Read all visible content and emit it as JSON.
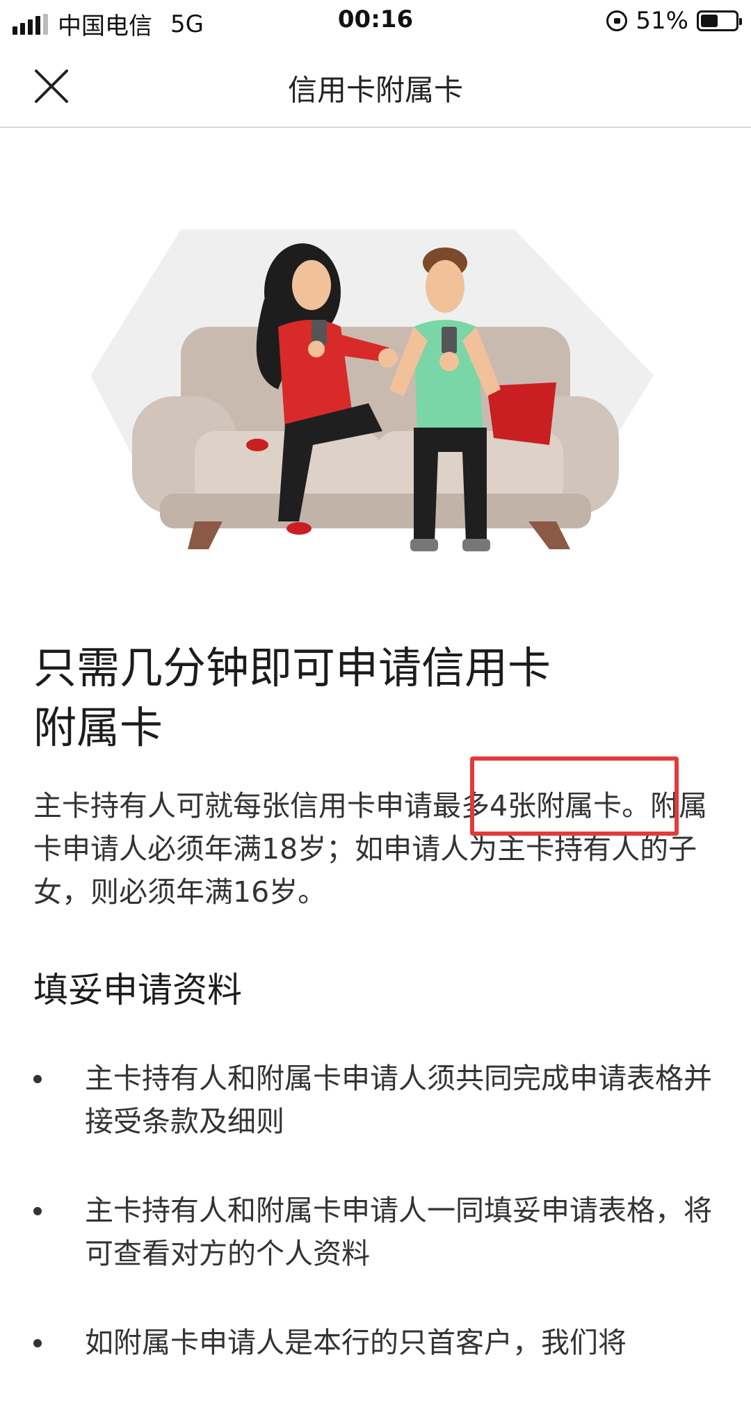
{
  "status_bar": {
    "carrier": "中国电信",
    "network": "5G",
    "time": "00:16",
    "battery": "51%",
    "battery_level": 0.51
  },
  "nav": {
    "title": "信用卡附属卡"
  },
  "hero": {
    "icon": "couple-on-sofa-illustration"
  },
  "content": {
    "headline_line1": "只需几分钟即可申请信用卡",
    "headline_line2": "附属卡",
    "intro": "主卡持有人可就每张信用卡申请最多4张附属卡。附属卡申请人必须年满18岁；如申请人为主卡持有人的子女，则必须年满16岁。",
    "section_title": "填妥申请资料",
    "bullets": [
      "主卡持有人和附属卡申请人须共同完成申请表格并接受条款及细则",
      "主卡持有人和附属卡申请人一同填妥申请表格，将可查看对方的个人资料",
      "如附属卡申请人是本行的只首客户，我们将"
    ]
  },
  "colors": {
    "highlight": "#e23b3b",
    "sofa": "#cfc2b8",
    "shirt_red": "#d92a2a",
    "shirt_green": "#7ad6a6"
  }
}
